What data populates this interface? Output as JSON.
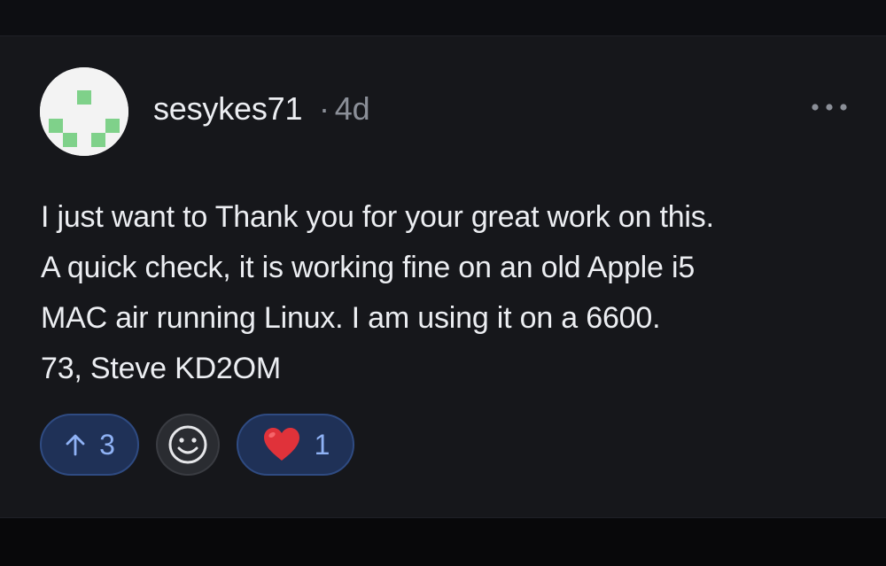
{
  "post": {
    "username": "sesykes71",
    "separator": "·",
    "age": "4d",
    "body": "I just want to Thank you for your great work on this.\nA quick check, it is working fine on an old Apple i5\nMAC air running Linux. I am using it on a 6600.\n73, Steve KD2OM",
    "avatar_colors": {
      "background": "#f3f3f3",
      "pixels": "#7fd18a"
    }
  },
  "reactions": {
    "upvote": {
      "icon": "arrow-up-icon",
      "count": "3"
    },
    "emoji_picker": {
      "icon": "smiley-icon"
    },
    "heart": {
      "icon": "heart-icon",
      "count": "1"
    }
  },
  "menu": {
    "icon": "more-horizontal-icon"
  },
  "colors": {
    "background": "#16171b",
    "text": "#eceef2",
    "muted": "#8b8f98",
    "accent_fill": "#1f3157",
    "accent_border": "#2f4b82",
    "accent_text": "#8fb2f5",
    "heart": "#e0323a"
  }
}
